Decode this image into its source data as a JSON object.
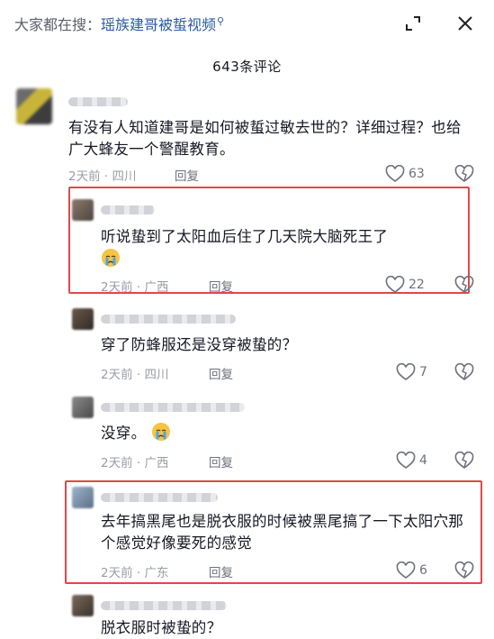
{
  "header": {
    "search_prefix": "大家都在搜：",
    "search_keyword": "瑶族建哥被蜇视频",
    "search_icon": "search-icon",
    "expand_icon": "expand-icon",
    "close_icon": "close-icon"
  },
  "comment_count": "643条评论",
  "comments": [
    {
      "text": "有没有人知道建哥是如何被蜇过敏去世的？详细过程？也给广大蜂友一个警醒教育。",
      "time": "2天前 · 四川",
      "reply_label": "回复",
      "likes": "63"
    },
    {
      "text": "听说蛰到了太阳血后住了几天院大脑死王了",
      "time": "2天前 · 广西",
      "reply_label": "回复",
      "likes": "22",
      "emoji": "crying-face-emoji"
    },
    {
      "text": "穿了防蜂服还是没穿被蛰的？",
      "time": "2天前 · 四川",
      "reply_label": "回复",
      "likes": "7"
    },
    {
      "text": "没穿。",
      "time": "2天前 · 广西",
      "reply_label": "回复",
      "likes": "4",
      "emoji": "crying-face-emoji"
    },
    {
      "text": "去年搞黑尾也是脱衣服的时候被黑尾搞了一下太阳穴那个感觉好像要死的感觉",
      "time": "2天前 · 广东",
      "reply_label": "回复",
      "likes": "6"
    },
    {
      "text": "脱衣服时被蛰的？"
    }
  ],
  "colors": {
    "highlight": "#e0474c",
    "keyword": "#2b5aa8"
  }
}
